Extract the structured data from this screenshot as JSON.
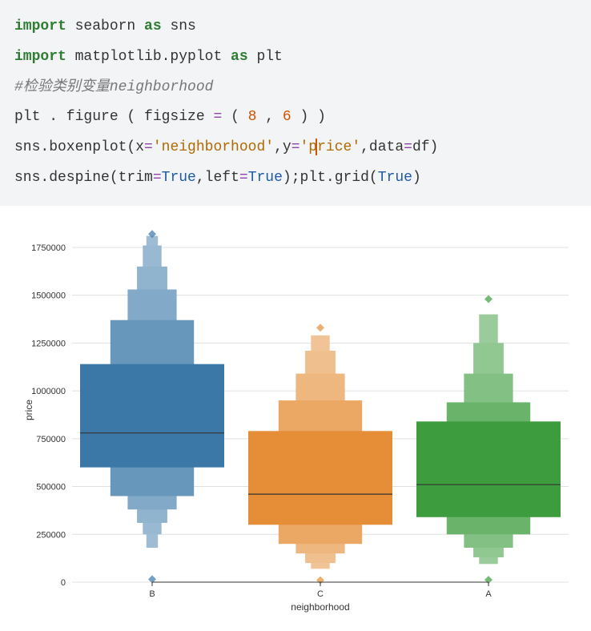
{
  "code": {
    "l1_kw1": "import",
    "l1_mod": " seaborn ",
    "l1_kw2": "as",
    "l1_alias": " sns",
    "l2_kw1": "import",
    "l2_mod": " matplotlib.pyplot ",
    "l2_kw2": "as",
    "l2_alias": " plt",
    "l3_cmt": "#检验类别变量neighborhood",
    "l4_a": "plt . figure ( figsize ",
    "l4_eq": "=",
    "l4_b": " ( ",
    "l4_n1": "8",
    "l4_c": " , ",
    "l4_n2": "6",
    "l4_d": " ) )",
    "l5_a": "sns.boxenplot(x",
    "l5_eq1": "=",
    "l5_s1": "'neighborhood'",
    "l5_b": ",y",
    "l5_eq2": "=",
    "l5_s2a": "'p",
    "l5_s2b": "rice'",
    "l5_c": ",data",
    "l5_eq3": "=",
    "l5_d": "df)",
    "l6_a": "sns.despine(trim",
    "l6_eq1": "=",
    "l6_t1": "True",
    "l6_b": ",left",
    "l6_eq2": "=",
    "l6_t2": "True",
    "l6_c": ");plt.grid(",
    "l6_t3": "True",
    "l6_d": ")"
  },
  "chart_data": {
    "type": "boxen",
    "xlabel": "neighborhood",
    "ylabel": "price",
    "ylim": [
      0,
      1800000
    ],
    "yticks": [
      0,
      250000,
      500000,
      750000,
      1000000,
      1250000,
      1500000,
      1750000
    ],
    "categories": [
      "B",
      "C",
      "A"
    ],
    "colors": [
      "#3b78a8",
      "#e58e37",
      "#3d9c3d"
    ],
    "series": [
      {
        "name": "B",
        "median": 780000,
        "boxes": [
          [
            600000,
            1140000,
            1.0
          ],
          [
            450000,
            1370000,
            0.58
          ],
          [
            380000,
            1530000,
            0.34
          ],
          [
            310000,
            1650000,
            0.21
          ],
          [
            250000,
            1760000,
            0.13
          ],
          [
            180000,
            1810000,
            0.08
          ]
        ],
        "diamonds": [
          15000,
          1820000
        ]
      },
      {
        "name": "C",
        "median": 460000,
        "boxes": [
          [
            300000,
            790000,
            1.0
          ],
          [
            200000,
            950000,
            0.58
          ],
          [
            150000,
            1090000,
            0.34
          ],
          [
            100000,
            1210000,
            0.21
          ],
          [
            70000,
            1290000,
            0.13
          ]
        ],
        "diamonds": [
          10000,
          1330000
        ]
      },
      {
        "name": "A",
        "median": 510000,
        "boxes": [
          [
            340000,
            840000,
            1.0
          ],
          [
            250000,
            940000,
            0.58
          ],
          [
            180000,
            1090000,
            0.34
          ],
          [
            130000,
            1250000,
            0.21
          ],
          [
            95000,
            1400000,
            0.13
          ]
        ],
        "diamonds": [
          12000,
          1480000
        ]
      }
    ]
  }
}
